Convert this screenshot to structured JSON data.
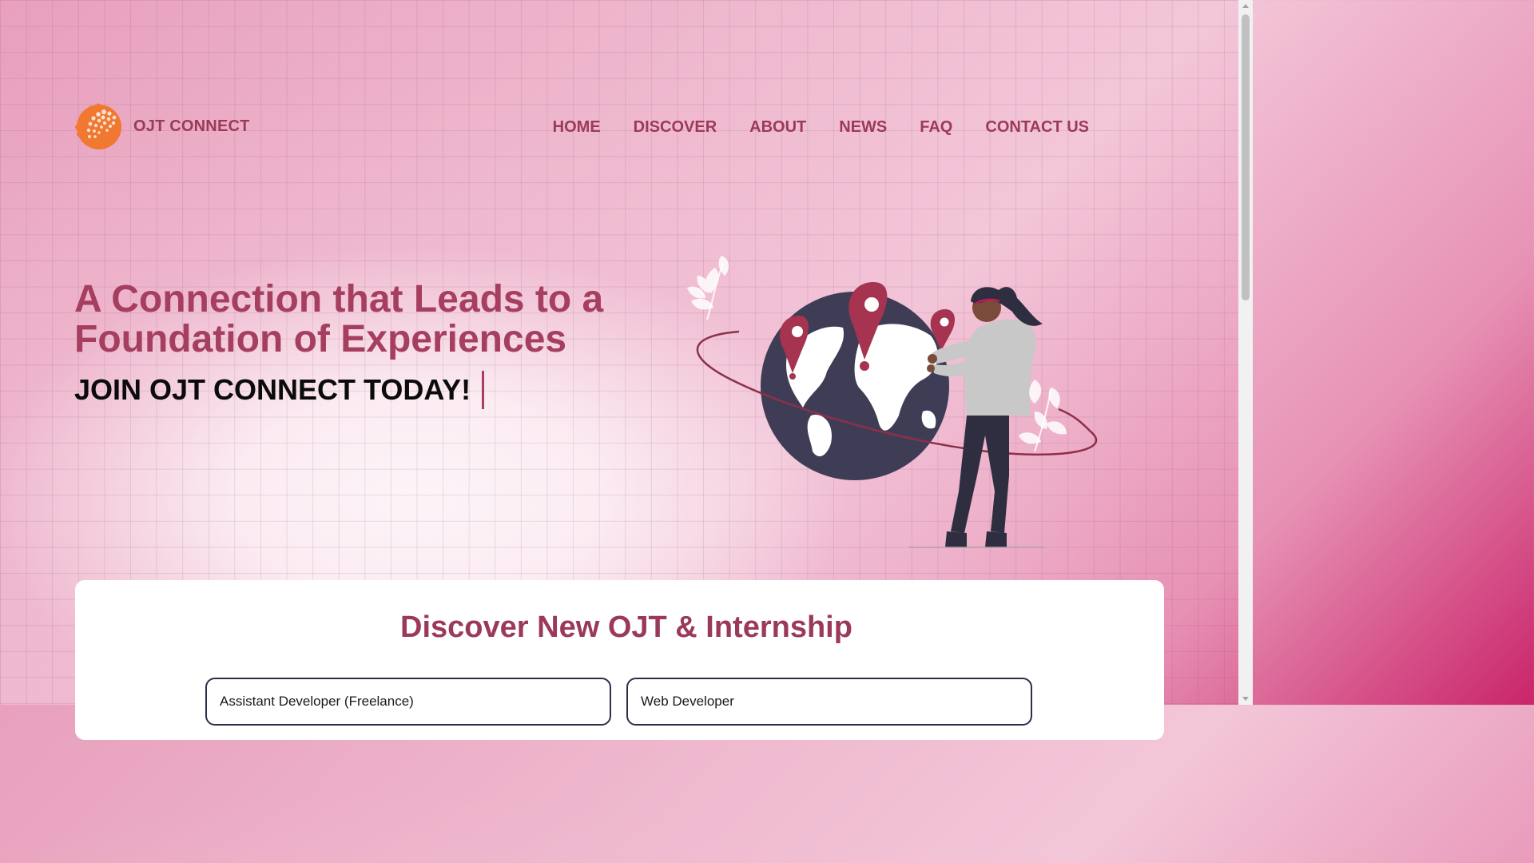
{
  "brand": {
    "name": "OJT CONNECT",
    "logo_icon": "orange-dotted-sphere-logo"
  },
  "nav": {
    "items": [
      "HOME",
      "DISCOVER",
      "ABOUT",
      "NEWS",
      "FAQ",
      "CONTACT US"
    ]
  },
  "hero": {
    "title": "A Connection that Leads to a Foundation of Experiences",
    "subtitle": "JOIN OJT CONNECT TODAY!"
  },
  "discover": {
    "title": "Discover New OJT & Internship",
    "jobs": [
      {
        "title": "Assistant Developer (Freelance)"
      },
      {
        "title": "Web Developer"
      }
    ]
  },
  "colors": {
    "accent": "#9b3a58",
    "logo": "#f07830",
    "globe": "#3f3d56",
    "pin": "#a63350"
  }
}
